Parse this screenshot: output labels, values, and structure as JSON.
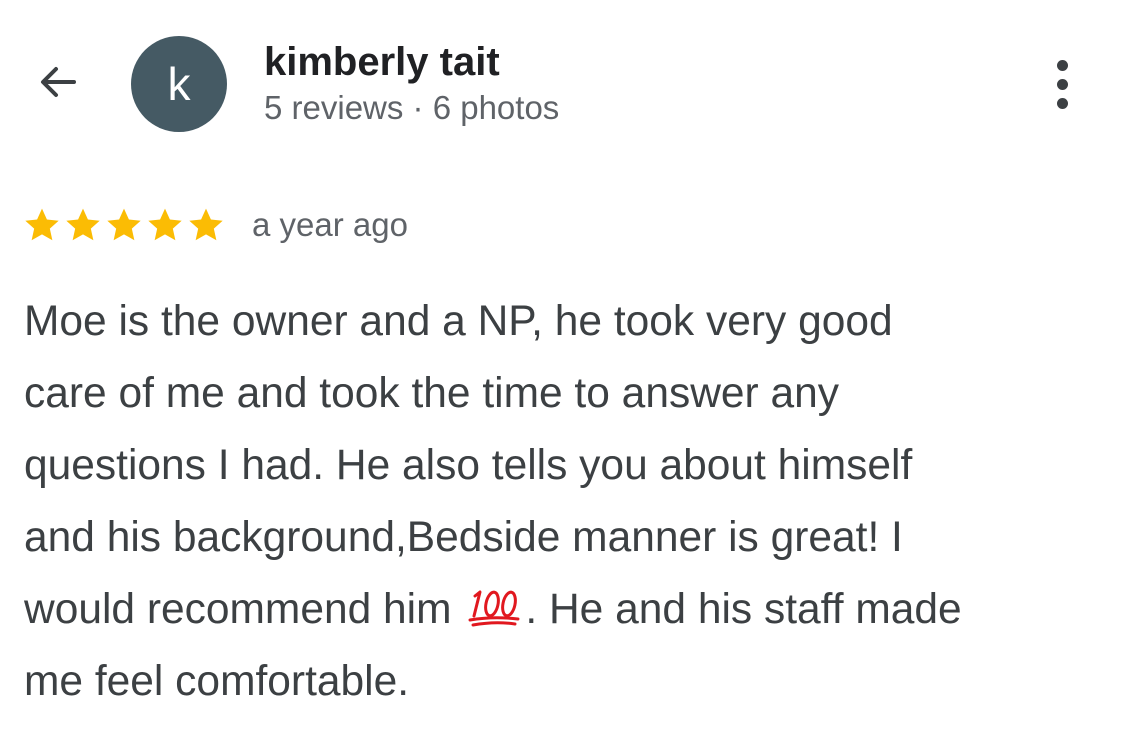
{
  "header": {
    "back_icon": "arrow-left-icon",
    "avatar_initial": "k",
    "avatar_color": "#455a64",
    "user_name": "kimberly tait",
    "user_meta": "5 reviews · 6 photos",
    "more_icon": "more-vert-icon"
  },
  "review": {
    "rating": 5,
    "rating_max": 5,
    "star_color": "#fbbc04",
    "time_ago": "a year ago",
    "lines": [
      "Moe is the owner and a NP, he took very good",
      "care of me and took the time to answer any",
      "questions I had. He also tells you about himself",
      "and his background,Bedside manner is great! I",
      "would recommend him",
      ". He and his staff made",
      "me feel comfortable."
    ],
    "emoji_icon": "hundred-points-icon",
    "emoji_color": "#e1181f"
  }
}
